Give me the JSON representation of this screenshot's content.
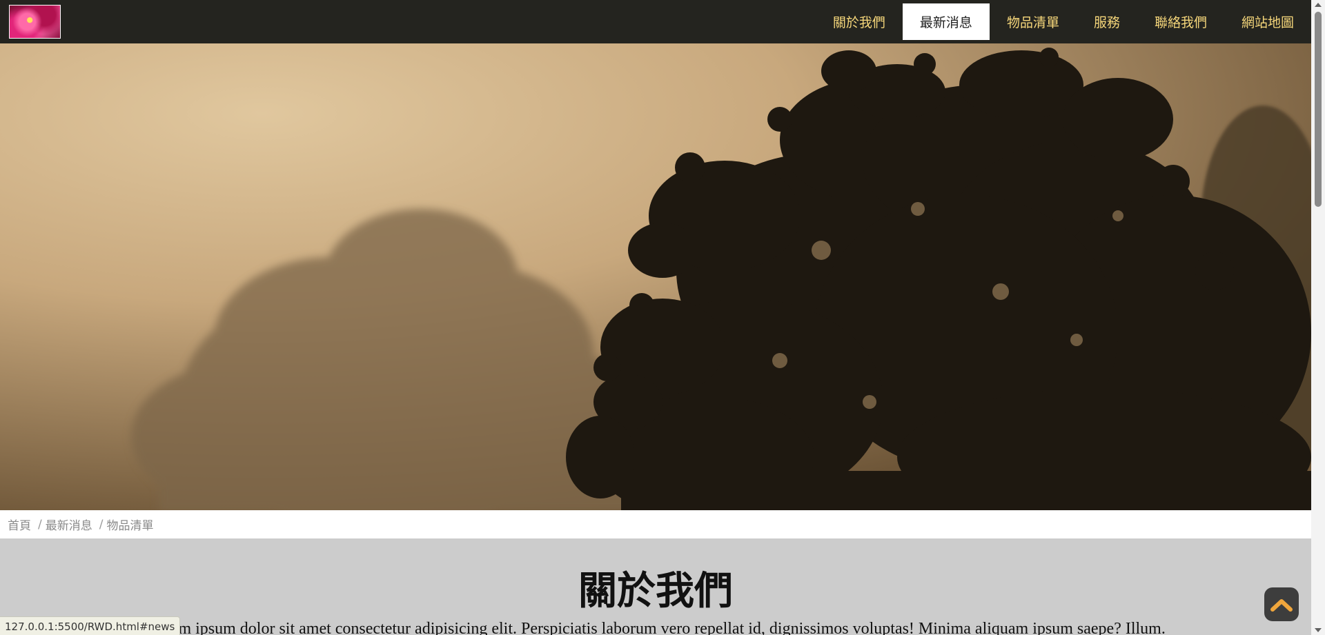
{
  "navbar": {
    "logo": "flower-logo",
    "items": [
      {
        "label": "關於我們",
        "active": false
      },
      {
        "label": "最新消息",
        "active": true
      },
      {
        "label": "物品清單",
        "active": false
      },
      {
        "label": "服務",
        "active": false
      },
      {
        "label": "聯絡我們",
        "active": false
      },
      {
        "label": "網站地圖",
        "active": false
      }
    ]
  },
  "hero": {
    "image": "foggy-trees-sunrise"
  },
  "breadcrumb": {
    "items": [
      "首頁",
      "最新消息",
      "物品清單"
    ],
    "separator": "/"
  },
  "section": {
    "title": "關於我們",
    "text": "Lorem ipsum dolor sit amet consectetur adipisicing elit. Perspiciatis laborum vero repellat id, dignissimos voluptas! Minima aliquam ipsum saepe? Illum."
  },
  "back_to_top": {
    "icon": "chevron-up-icon",
    "color": "#f0a63c"
  },
  "status_bar": {
    "url": "127.0.0.1:5500/RWD.html#news"
  },
  "colors": {
    "navbar_bg": "#24241f",
    "nav_text": "#f5d67a",
    "content_bg": "#cccccc"
  }
}
